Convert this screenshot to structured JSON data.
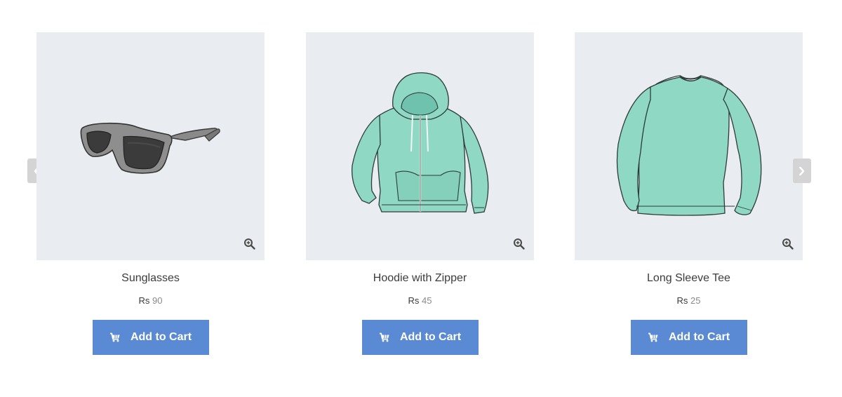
{
  "carousel": {
    "prev_icon": "chevron-left-icon",
    "next_icon": "chevron-right-icon",
    "products": [
      {
        "name": "Sunglasses",
        "currency": "Rs",
        "price": "90",
        "button": "Add to Cart",
        "image": "sunglasses"
      },
      {
        "name": "Hoodie with Zipper",
        "currency": "Rs",
        "price": "45",
        "button": "Add to Cart",
        "image": "hoodie"
      },
      {
        "name": "Long Sleeve Tee",
        "currency": "Rs",
        "price": "25",
        "button": "Add to Cart",
        "image": "long-sleeve-tee"
      }
    ]
  },
  "colors": {
    "button": "#5b8ad5",
    "image_bg": "#e9edf1",
    "arrow_bg": "#d4d4d4",
    "mint": "#8fd8c4"
  }
}
